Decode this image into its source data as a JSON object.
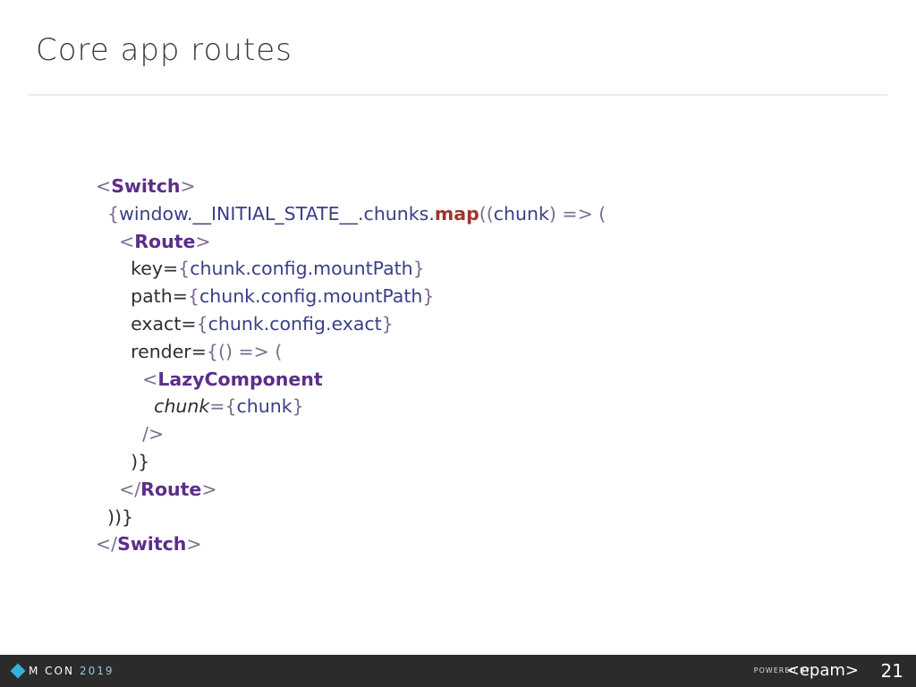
{
  "slide": {
    "title": "Core app routes",
    "page_number": "21"
  },
  "code_lines": [
    [
      {
        "t": "<",
        "c": "punc"
      },
      {
        "t": "Switch",
        "c": "tag"
      },
      {
        "t": ">",
        "c": "punc"
      }
    ],
    [
      {
        "t": "  {",
        "c": "punc"
      },
      {
        "t": "window.__INITIAL_STATE__.chunks.",
        "c": "blue"
      },
      {
        "t": "map",
        "c": "fn"
      },
      {
        "t": "((",
        "c": "punc"
      },
      {
        "t": "chunk",
        "c": "blue"
      },
      {
        "t": ") => (",
        "c": "punc"
      }
    ],
    [
      {
        "t": "    <",
        "c": "punc"
      },
      {
        "t": "Route",
        "c": "tag"
      },
      {
        "t": ">",
        "c": "punc"
      }
    ],
    [
      {
        "t": "      key=",
        "c": "attr"
      },
      {
        "t": "{",
        "c": "punc"
      },
      {
        "t": "chunk.config.mountPath",
        "c": "blue"
      },
      {
        "t": "}",
        "c": "punc"
      }
    ],
    [
      {
        "t": "      path=",
        "c": "attr"
      },
      {
        "t": "{",
        "c": "punc"
      },
      {
        "t": "chunk.config.mountPath",
        "c": "blue"
      },
      {
        "t": "}",
        "c": "punc"
      }
    ],
    [
      {
        "t": "      exact=",
        "c": "attr"
      },
      {
        "t": "{",
        "c": "punc"
      },
      {
        "t": "chunk.config.exact",
        "c": "blue"
      },
      {
        "t": "}",
        "c": "punc"
      }
    ],
    [
      {
        "t": "      render=",
        "c": "attr"
      },
      {
        "t": "{() => (",
        "c": "punc"
      }
    ],
    [
      {
        "t": "        <",
        "c": "punc"
      },
      {
        "t": "LazyComponent",
        "c": "tag"
      }
    ],
    [
      {
        "t": "          ",
        "c": "attr"
      },
      {
        "t": "chunk",
        "c": "prop"
      },
      {
        "t": "={",
        "c": "punc"
      },
      {
        "t": "chunk",
        "c": "blue"
      },
      {
        "t": "}",
        "c": "punc"
      }
    ],
    [
      {
        "t": "        />",
        "c": "punc"
      }
    ],
    [
      {
        "t": "      )}",
        "c": "attr"
      }
    ],
    [
      {
        "t": "    </",
        "c": "punc"
      },
      {
        "t": "Route",
        "c": "tag"
      },
      {
        "t": ">",
        "c": "punc"
      }
    ],
    [
      {
        "t": "  ))}",
        "c": "attr"
      }
    ],
    [
      {
        "t": "</",
        "c": "punc"
      },
      {
        "t": "Switch",
        "c": "tag"
      },
      {
        "t": ">",
        "c": "punc"
      }
    ]
  ],
  "footer": {
    "logo_text": "M CON",
    "logo_year": "2019",
    "powered_by": "POWERED BY",
    "epam": "<epam>"
  },
  "colors": {
    "footer_bg": "#2b2b2b",
    "tag": "#5b2e8a",
    "function": "#a0342f",
    "identifier": "#3a3f86"
  }
}
